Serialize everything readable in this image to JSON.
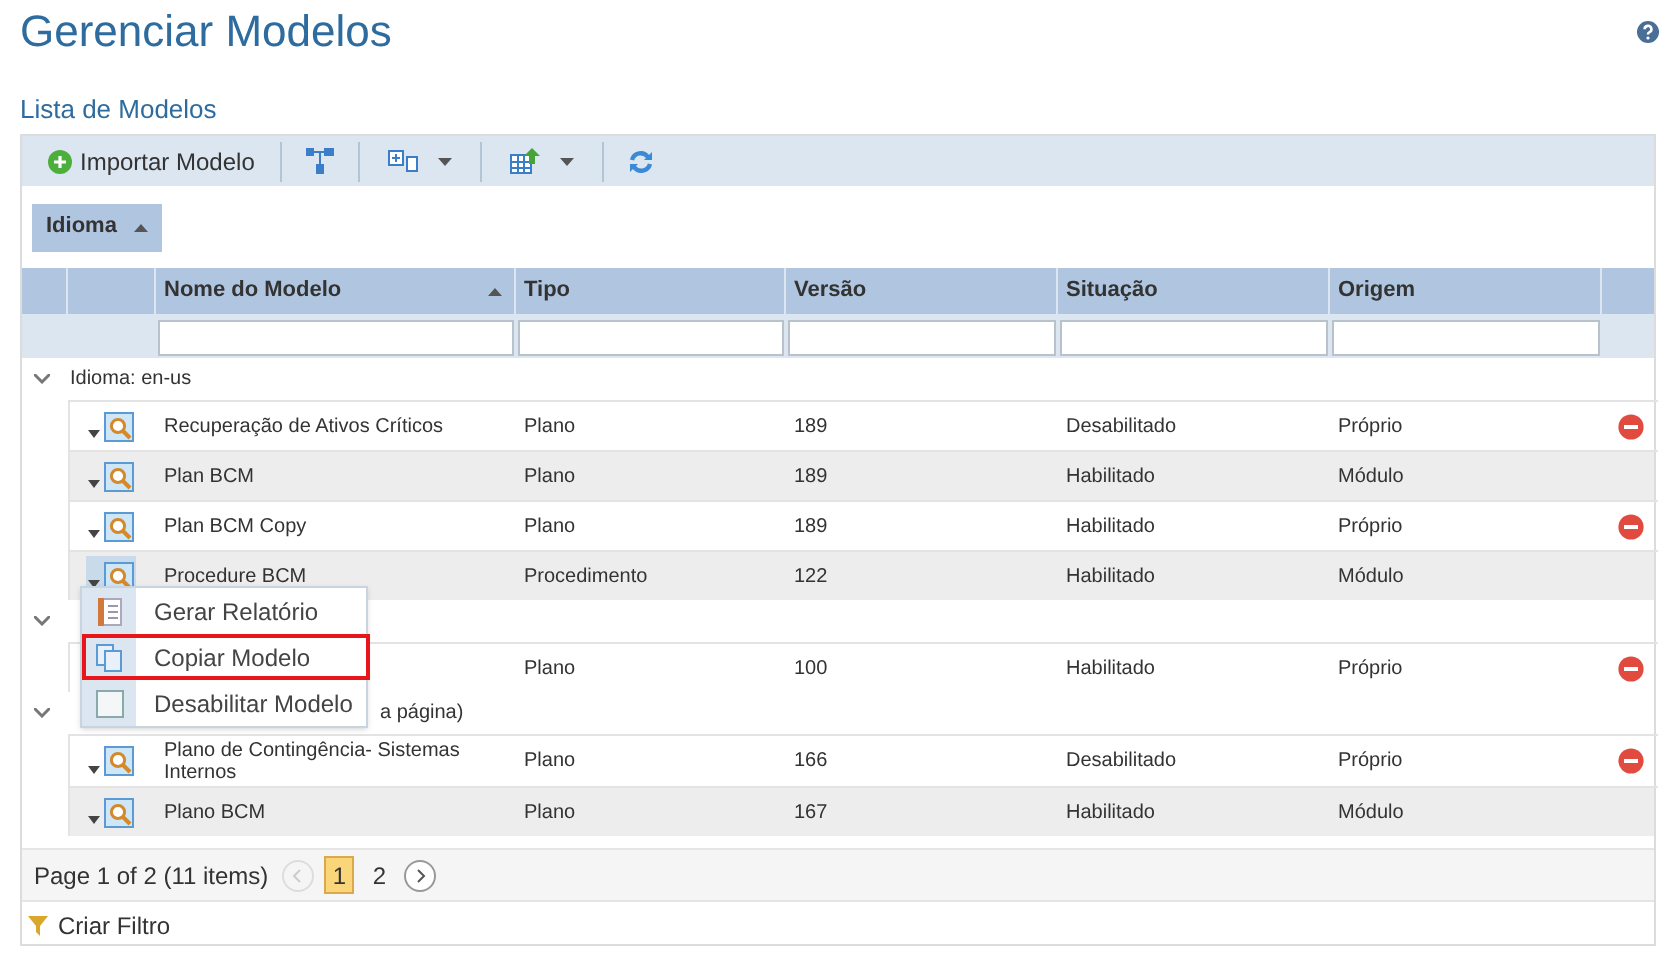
{
  "page": {
    "title": "Gerenciar Modelos"
  },
  "panel": {
    "title": "Lista de Modelos"
  },
  "toolbar": [
    {
      "kind": "text",
      "label": "Importar Modelo"
    },
    {
      "kind": "icon"
    },
    {
      "kind": "dropdown"
    },
    {
      "kind": "dropdown"
    },
    {
      "kind": "icon"
    }
  ],
  "group_by": [
    {
      "label": "Idioma"
    }
  ],
  "table": {
    "columns": [
      "Nome do Modelo",
      "Tipo",
      "Versão",
      "Situação",
      "Origem"
    ],
    "groups": [
      {
        "label": "Idioma: en-us",
        "covered": false,
        "rows": [
          {
            "name": "Recuperação de Ativos Críticos",
            "tipo": "Plano",
            "versao": "189",
            "situacao": "Desabilitado",
            "origem": "Próprio",
            "removable": true,
            "menu_open": false
          },
          {
            "name": "Plan BCM",
            "tipo": "Plano",
            "versao": "189",
            "situacao": "Habilitado",
            "origem": "Módulo",
            "removable": false,
            "menu_open": false
          },
          {
            "name": "Plan BCM Copy",
            "tipo": "Plano",
            "versao": "189",
            "situacao": "Habilitado",
            "origem": "Próprio",
            "removable": true,
            "menu_open": false
          },
          {
            "name": "Procedure BCM",
            "tipo": "Procedimento",
            "versao": "122",
            "situacao": "Habilitado",
            "origem": "Módulo",
            "removable": false,
            "menu_open": true
          }
        ]
      },
      {
        "rows": [
          {
            "tipo": "Plano",
            "versao": "100",
            "situacao": "Habilitado",
            "origem": "Próprio",
            "removable": true
          }
        ]
      },
      {
        "label": "a página)",
        "covered": true,
        "rows": [
          {
            "name": "Plano de Contingência- Sistemas Internos",
            "tipo": "Plano",
            "versao": "166",
            "situacao": "Desabilitado",
            "origem": "Próprio",
            "removable": true,
            "menu_open": false
          },
          {
            "name": "Plano BCM",
            "tipo": "Plano",
            "versao": "167",
            "situacao": "Habilitado",
            "origem": "Módulo",
            "removable": false,
            "menu_open": false
          }
        ]
      }
    ]
  },
  "menu": [
    {
      "label": "Gerar Relatório",
      "selected": false
    },
    {
      "label": "Copiar Modelo",
      "selected": true
    },
    {
      "label": "Desabilitar Modelo",
      "selected": false
    }
  ],
  "pager": {
    "summary": "Page 1 of 2 (11 items)",
    "pages": [
      {
        "label": "1",
        "selected": true
      },
      {
        "label": "2",
        "selected": false
      }
    ]
  },
  "footer": {
    "label": "Criar Filtro"
  }
}
